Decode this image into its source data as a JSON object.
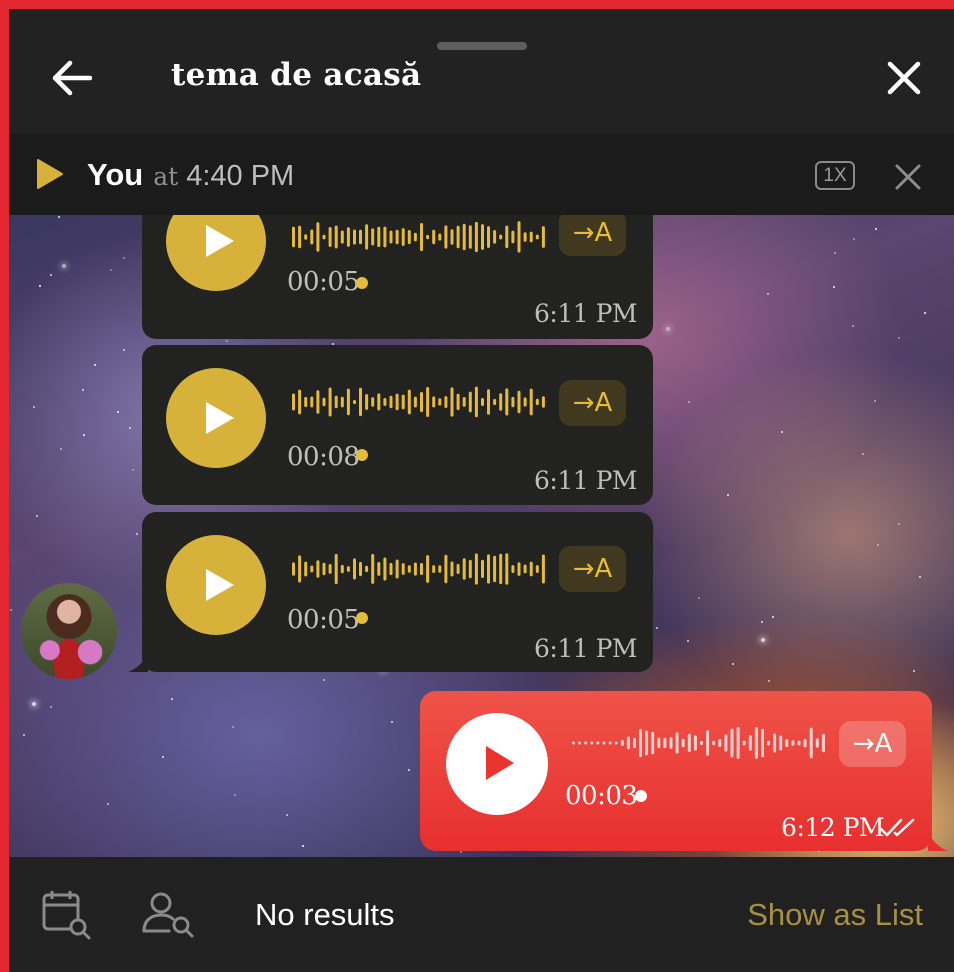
{
  "header": {
    "title": "tema de acasă",
    "back_icon": "arrow-left-icon",
    "close_icon": "close-icon"
  },
  "player": {
    "name": "You",
    "at": "at",
    "time": "4:40 PM",
    "speed": "1X",
    "play_icon": "play-icon",
    "close_icon": "close-icon"
  },
  "messages": [
    {
      "direction": "incoming",
      "duration": "00:05",
      "time": "6:11 PM",
      "transcribe_label": "→A"
    },
    {
      "direction": "incoming",
      "duration": "00:08",
      "time": "6:11 PM",
      "transcribe_label": "→A"
    },
    {
      "direction": "incoming",
      "duration": "00:05",
      "time": "6:11 PM",
      "transcribe_label": "→A"
    },
    {
      "direction": "outgoing",
      "duration": "00:03",
      "time": "6:12 PM",
      "transcribe_label": "→A",
      "status": "read"
    }
  ],
  "bottom": {
    "status": "No results",
    "show_list": "Show as List",
    "calendar_icon": "calendar-search-icon",
    "user_icon": "user-search-icon"
  },
  "colors": {
    "accent_yellow": "#d6b23a",
    "outgoing_red": "#e72f2f",
    "bubble_dark": "#222320",
    "header_bg": "#222222",
    "frame_red": "#e3262f"
  }
}
